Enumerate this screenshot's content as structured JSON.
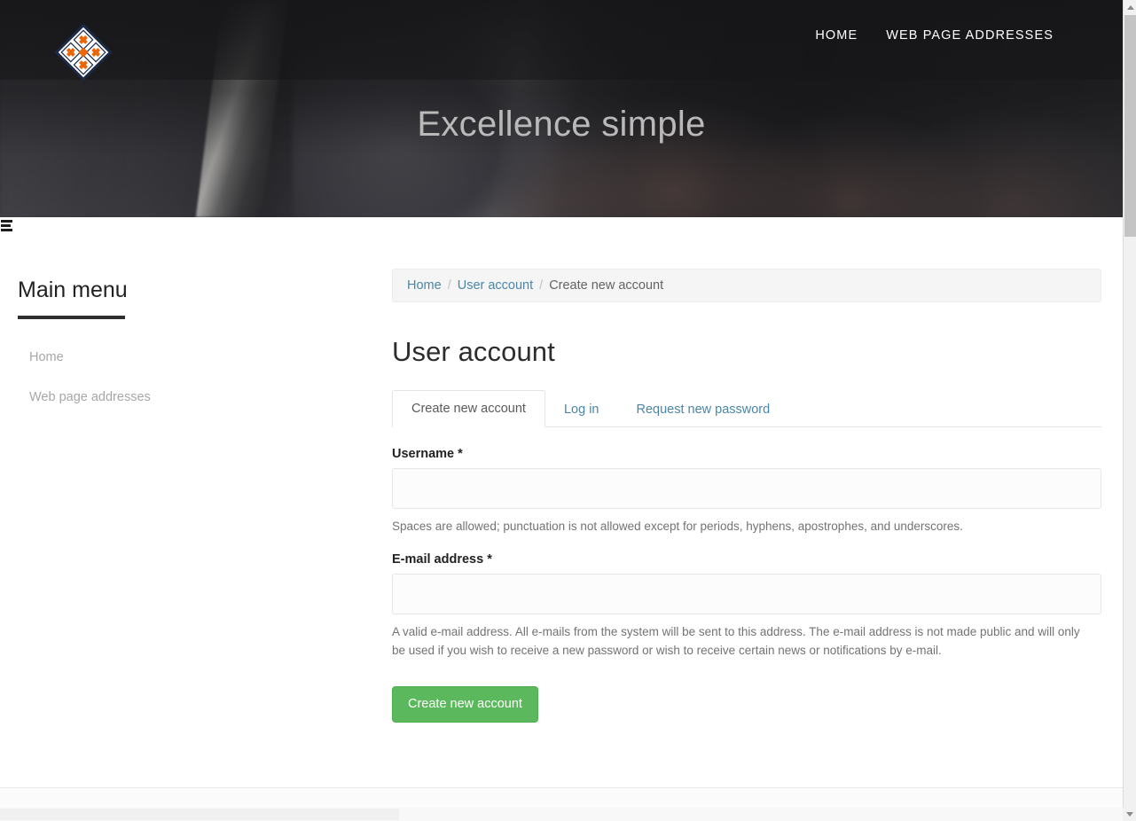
{
  "header": {
    "logo_icon": "diamond-logo-icon",
    "nav": [
      {
        "label": "HOME"
      },
      {
        "label": "WEB PAGE ADDRESSES"
      }
    ],
    "hero_title": "Excellence simple"
  },
  "menu_toggle": {
    "icon": "hamburger-menu-icon"
  },
  "sidebar": {
    "heading": "Main menu",
    "items": [
      {
        "label": "Home"
      },
      {
        "label": "Web page addresses"
      }
    ]
  },
  "breadcrumb": {
    "items": [
      {
        "label": "Home",
        "link": true
      },
      {
        "label": "User account",
        "link": true
      },
      {
        "label": "Create new account",
        "link": false
      }
    ],
    "separator": "/"
  },
  "main": {
    "page_title": "User account",
    "tabs": [
      {
        "label": "Create new account",
        "active": true
      },
      {
        "label": "Log in",
        "active": false
      },
      {
        "label": "Request new password",
        "active": false
      }
    ],
    "form": {
      "username": {
        "label": "Username",
        "required_marker": "*",
        "value": "",
        "placeholder": "",
        "help": "Spaces are allowed; punctuation is not allowed except for periods, hyphens, apostrophes, and underscores."
      },
      "email": {
        "label": "E-mail address",
        "required_marker": "*",
        "value": "",
        "placeholder": "",
        "help": "A valid e-mail address. All e-mails from the system will be sent to this address. The e-mail address is not made public and will only be used if you wish to receive a new password or wish to receive certain news or notifications by e-mail."
      },
      "submit_label": "Create new account"
    }
  },
  "colors": {
    "accent_orange": "#ec6608",
    "link_blue": "#4a86a8",
    "button_green": "#5cb85c",
    "hero_dark": "#2b2b2d",
    "logo_navy": "#1b2a47"
  }
}
